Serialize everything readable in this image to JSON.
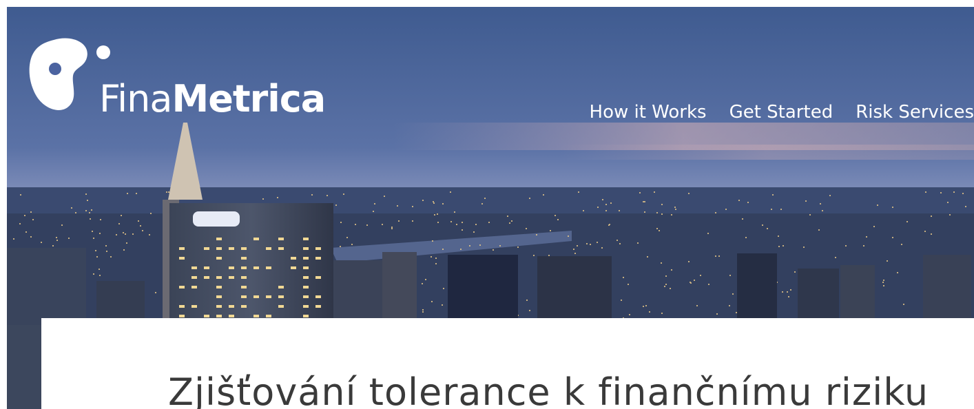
{
  "brand": {
    "name_part1": "Fina",
    "name_part2": "Metrica"
  },
  "nav": {
    "items": [
      {
        "label": "How it Works"
      },
      {
        "label": "Get Started"
      },
      {
        "label": "Risk Services"
      }
    ]
  },
  "main": {
    "title": "Zjišťování tolerance k finančnímu riziku"
  },
  "colors": {
    "sky_top": "#3e5a8e",
    "sky_bottom": "#8796c0",
    "city": "#2c3a5a",
    "text_dark": "#3a3a3a",
    "white": "#ffffff"
  }
}
